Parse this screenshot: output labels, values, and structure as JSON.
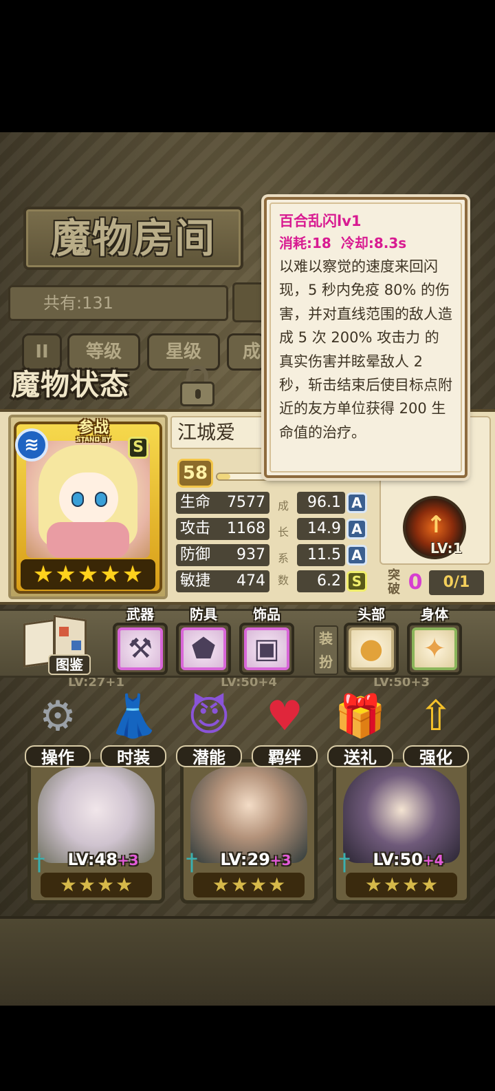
{
  "room": {
    "title": "魔物房间",
    "total_count": "共有:131",
    "sort_tabs": [
      "等级",
      "星级",
      "成"
    ],
    "tab_icon": "II"
  },
  "status": {
    "title": "魔物状态",
    "character": {
      "standby_label": "参战",
      "standby_sub": "STAND BY",
      "element_icon": "water-icon",
      "rank": "S",
      "stars": 5,
      "name": "江城爱",
      "level": "58",
      "exp_fraction": 0.25
    },
    "stats": [
      {
        "label": "生命",
        "value": "7577",
        "growth": "96.1",
        "grade": "A"
      },
      {
        "label": "攻击",
        "value": "1168",
        "growth": "14.9",
        "grade": "A"
      },
      {
        "label": "防御",
        "value": "937",
        "growth": "11.5",
        "grade": "A"
      },
      {
        "label": "敏捷",
        "value": "474",
        "growth": "6.2",
        "grade": "S"
      }
    ],
    "growth_label": [
      "成",
      "长",
      "系",
      "数"
    ],
    "skill": {
      "lv": "LV:1"
    },
    "breakthrough": {
      "label": "突破",
      "count": "0",
      "progress": "0/1"
    }
  },
  "equipment": {
    "book_label": "图鉴",
    "weapon_label": "武器",
    "armor_label": "防具",
    "accessory_label": "饰品",
    "dress_label": "装扮",
    "head_label": "头部",
    "body_label": "身体"
  },
  "actions": [
    "操作",
    "时装",
    "潜能",
    "羁绊",
    "送礼",
    "强化"
  ],
  "roster": [
    {
      "lv": "LV:48",
      "plus": "+3",
      "stars": 4
    },
    {
      "lv": "LV:29",
      "plus": "+3",
      "stars": 4
    },
    {
      "lv": "LV:50",
      "plus": "+4",
      "stars": 4
    }
  ],
  "roster_top": [
    "LV:27+1",
    "LV:50+4",
    "LV:50+3"
  ],
  "tooltip": {
    "title": "百合乱闪lv1",
    "cost": "消耗:18",
    "cooldown": "冷却:8.3s",
    "description": "以难以察觉的速度来回闪现，5 秒内免疫 80% 的伤害，并对直线范围的敌人造成 5 次 200% 攻击力 的真实伤害并眩晕敌人 2 秒，斩击结束后使目标点附近的友方单位获得 200 生命值的治疗。"
  }
}
